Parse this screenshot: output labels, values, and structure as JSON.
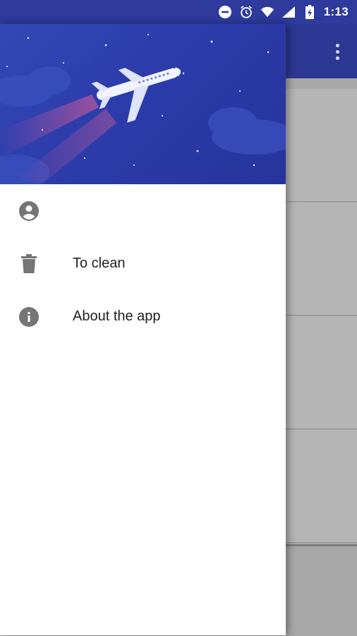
{
  "status_bar": {
    "time": "1:13",
    "icons": [
      "do-not-disturb-icon",
      "alarm-icon",
      "wifi-icon",
      "cellular-signal-icon",
      "battery-charging-icon"
    ]
  },
  "app_bar": {
    "overflow_icon": "more-vert-icon"
  },
  "drawer": {
    "header": {
      "image": "airplane-night-sky-illustration"
    },
    "items": [
      {
        "icon": "account-circle-icon",
        "label": ""
      },
      {
        "icon": "trash-icon",
        "label": "To clean"
      },
      {
        "icon": "info-icon",
        "label": "About the app"
      }
    ]
  },
  "colors": {
    "primary_dark": "#2e3a9c",
    "primary": "#2c3893",
    "header_blue": "#3447b6",
    "icon_gray": "#757575",
    "text": "#212121"
  }
}
